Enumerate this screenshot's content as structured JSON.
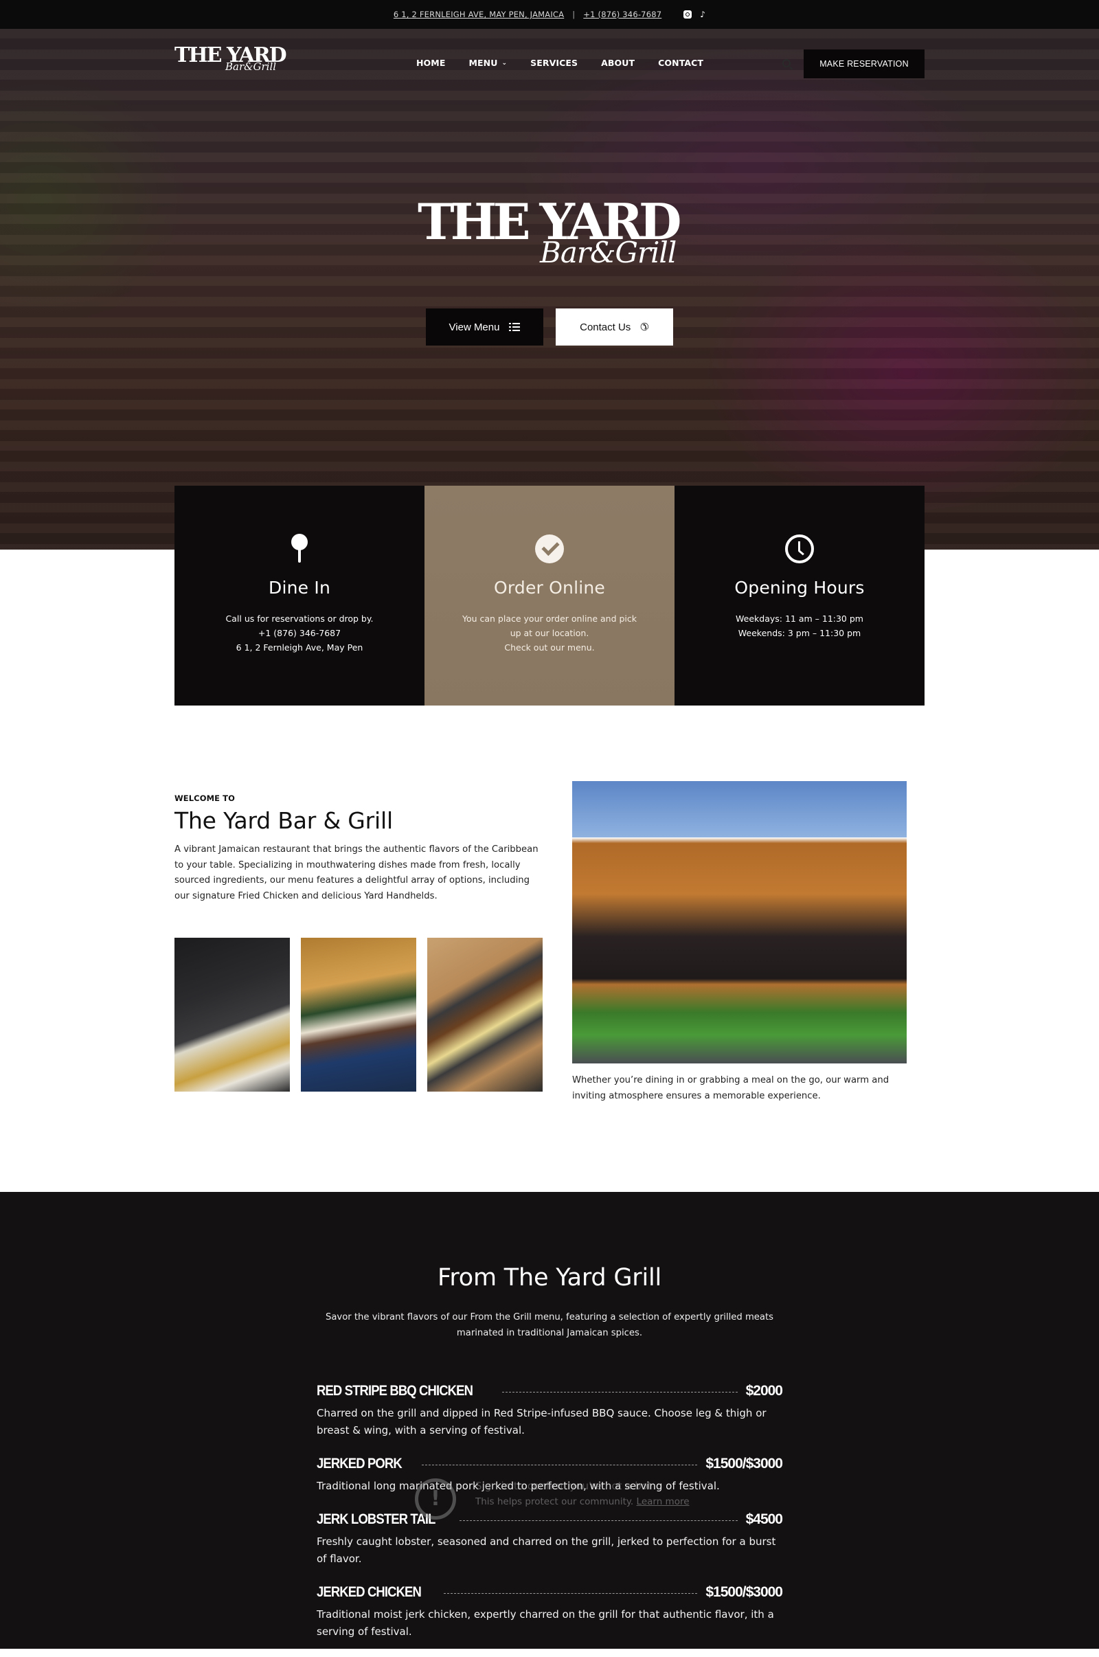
{
  "topbar": {
    "address": "6 1, 2 FERNLEIGH AVE, MAY PEN, JAMAICA",
    "separator": "|",
    "phone": "+1 (876) 346-7687",
    "social": [
      {
        "icon": "instagram-icon"
      },
      {
        "icon": "tiktok-icon",
        "glyph": "♪"
      }
    ]
  },
  "nav": {
    "logo": {
      "main": "THE YARD",
      "script": "Bar&Grill"
    },
    "items": [
      {
        "label": "HOME"
      },
      {
        "label": "MENU",
        "chevron": "⌄"
      },
      {
        "label": "SERVICES"
      },
      {
        "label": "ABOUT"
      },
      {
        "label": "CONTACT"
      }
    ],
    "reserve_label": "MAKE RESERVATION"
  },
  "hero": {
    "logo": {
      "main": "THE YARD",
      "script": "Bar&Grill"
    },
    "view_menu_label": "View Menu",
    "contact_label": "Contact Us",
    "phone_glyph": "✆"
  },
  "cards": [
    {
      "title": "Dine In",
      "lines": [
        "Call us for reservations or drop by.",
        "+1 (876) 346-7687",
        "6 1, 2 Fernleigh Ave, May Pen"
      ]
    },
    {
      "title": "Order Online",
      "lines": [
        "You can place your order online and pick",
        "up at our location.",
        "Check out our menu."
      ]
    },
    {
      "title": "Opening Hours",
      "lines": [
        "Weekdays: 11 am – 11:30 pm",
        "Weekends: 3 pm – 11:30 pm"
      ]
    }
  ],
  "welcome": {
    "kicker": "WELCOME TO",
    "title": "The Yard Bar & Grill",
    "body": "A vibrant Jamaican restaurant that brings the authentic flavors of the Caribbean to your table. Specializing in mouthwatering dishes made from fresh, locally sourced ingredients, our menu features a delightful array of options, including our signature Fried Chicken and delicious Yard Handhelds.",
    "caption": "Whether you’re dining in or grabbing a meal on the go, our warm and inviting atmosphere ensures a memorable experience."
  },
  "grill": {
    "title": "From The Yard Grill",
    "intro": "Savor the vibrant flavors of our From the Grill menu, featuring a selection of expertly grilled meats marinated in traditional Jamaican spices.",
    "items": [
      {
        "name": "Red Stripe BBQ Chicken",
        "price": "$2000",
        "desc": "Charred on the grill and dipped in Red Stripe-infused BBQ sauce. Choose leg & thigh or breast & wing, with a serving of festival."
      },
      {
        "name": "Jerked Pork",
        "price": "$1500/$3000",
        "desc": "Traditional long marinated pork jerked to perfection, with a serving of festival."
      },
      {
        "name": "Jerk Lobster Tail",
        "price": "$4500",
        "desc": "Freshly caught lobster, seasoned and charred on the grill, jerked to perfection for a burst of flavor."
      },
      {
        "name": "Jerked Chicken",
        "price": "$1500/$3000",
        "desc": "Traditional moist jerk chicken, expertly charred on the grill for that authentic flavor, ith a serving of festival."
      }
    ]
  },
  "bot_notice": {
    "title": "Sign in to confirm you're not a bot",
    "body": "This helps protect our community.",
    "link": "Learn more"
  }
}
